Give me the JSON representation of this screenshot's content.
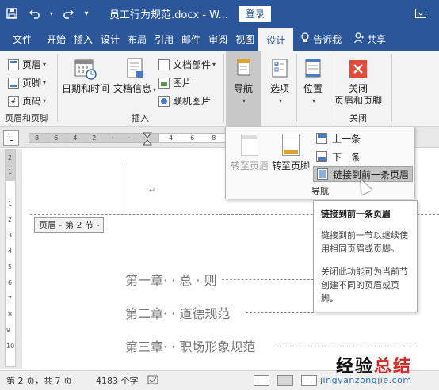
{
  "titlebar": {
    "save_icon": "save-icon",
    "title": "员工行为规范.docx - W...",
    "login": "登录"
  },
  "tabs": [
    {
      "label": "文件"
    },
    {
      "label": "开始"
    },
    {
      "label": "插入"
    },
    {
      "label": "设计"
    },
    {
      "label": "布局"
    },
    {
      "label": "引用"
    },
    {
      "label": "邮件"
    },
    {
      "label": "审阅"
    },
    {
      "label": "视图"
    },
    {
      "label": "设计",
      "active": true
    },
    {
      "label": "告诉我"
    },
    {
      "label": "共享"
    }
  ],
  "ribbon": {
    "header_footer": {
      "header": "页眉",
      "footer": "页脚",
      "page_number": "页码",
      "group_label": "页眉和页脚"
    },
    "insert": {
      "date_time": "日期和时间",
      "doc_info": "文档信息",
      "quick_parts": "文档部件",
      "pictures": "图片",
      "online_pictures": "联机图片",
      "group_label": "插入"
    },
    "navigation": {
      "label": "导航"
    },
    "options": {
      "label": "选项"
    },
    "position": {
      "label": "位置"
    },
    "close": {
      "label_line1": "关闭",
      "label_line2": "页眉和页脚",
      "group_label": "关闭"
    }
  },
  "ruler": {
    "corner": "L",
    "h_ticks": [
      "8",
      "6",
      "4",
      "2",
      "",
      "",
      "",
      "2",
      "4",
      "6"
    ],
    "h_ticks_right": [
      "4",
      "6",
      "8"
    ],
    "v_ticks": [
      "2",
      "1",
      "",
      "1",
      "2",
      "3",
      "4",
      "5",
      "6",
      "7",
      "8",
      "9",
      "10"
    ]
  },
  "nav_panel": {
    "goto_header": "转至页眉",
    "goto_footer": "转至页脚",
    "previous": "上一条",
    "next": "下一条",
    "link_previous": "链接到前一条页眉",
    "group_label": "导航"
  },
  "tooltip": {
    "title": "链接到前一条页眉",
    "p1": "链接到前一节以继续使用相同页眉或页脚。",
    "p2": "关闭此功能可为当前节创建不同的页眉或页脚。"
  },
  "document": {
    "header_tag": "页眉 - 第 2 节 -",
    "toc": [
      {
        "text": "第一章· · 总 · 则"
      },
      {
        "text": "第二章· · 道德规范"
      },
      {
        "text": "第三章· · 职场形象规范"
      }
    ]
  },
  "statusbar": {
    "page": "第 2 页，共 7 页",
    "words": "4183 个字"
  },
  "watermark": {
    "text_a": "经验",
    "text_b": "总结",
    "url": "jingyanzongjie.com"
  }
}
